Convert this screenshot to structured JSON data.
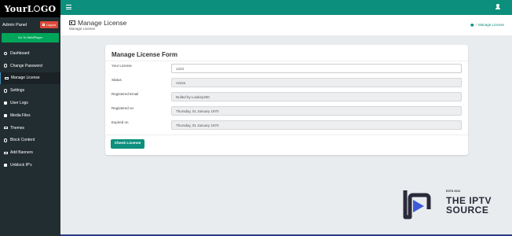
{
  "brand": {
    "logo_text_a": "Your",
    "logo_text_b": "L",
    "logo_text_c": "GO"
  },
  "sidebar": {
    "admin_label": "Admin Panel",
    "logout_label": "Logout",
    "webplayer_label": "Go To WebPlayer",
    "items": [
      {
        "label": "Dashboard",
        "icon": "dashboard-icon"
      },
      {
        "label": "Change Password",
        "icon": "key-icon"
      },
      {
        "label": "Manage License",
        "icon": "id-card-icon",
        "active": true
      },
      {
        "label": "Settings",
        "icon": "gear-icon"
      },
      {
        "label": "User Logs",
        "icon": "users-icon"
      },
      {
        "label": "Media Files",
        "icon": "media-icon"
      },
      {
        "label": "Themes",
        "icon": "image-icon"
      },
      {
        "label": "Block Content",
        "icon": "block-icon"
      },
      {
        "label": "Add Banners",
        "icon": "film-icon"
      },
      {
        "label": "Unblock IP's",
        "icon": "unlock-icon"
      }
    ]
  },
  "header": {
    "title": "Manage License",
    "subtitle": "Manage License",
    "breadcrumb_current": "Manage License"
  },
  "form": {
    "title": "Manage License Form",
    "fields": [
      {
        "label": "Your License",
        "value": "1223",
        "readonly": false
      },
      {
        "label": "Status",
        "value": "Active",
        "readonly": true
      },
      {
        "label": "Registered Email",
        "value": "Nulled by Lowkey250",
        "readonly": true
      },
      {
        "label": "Registered on",
        "value": "Thursday, 01 January 1970",
        "readonly": true
      },
      {
        "label": "Expired on",
        "value": "Thursday, 01 January 1970",
        "readonly": true
      }
    ],
    "submit_label": "Check License"
  },
  "watermark": {
    "since": "ESTD 2024",
    "line1": "THE IPTV",
    "line2": "SOURCE"
  },
  "colors": {
    "accent": "#0c8f7c",
    "sidebar": "#222d32",
    "logout": "#dd4b39",
    "webplayer": "#00a65a"
  }
}
